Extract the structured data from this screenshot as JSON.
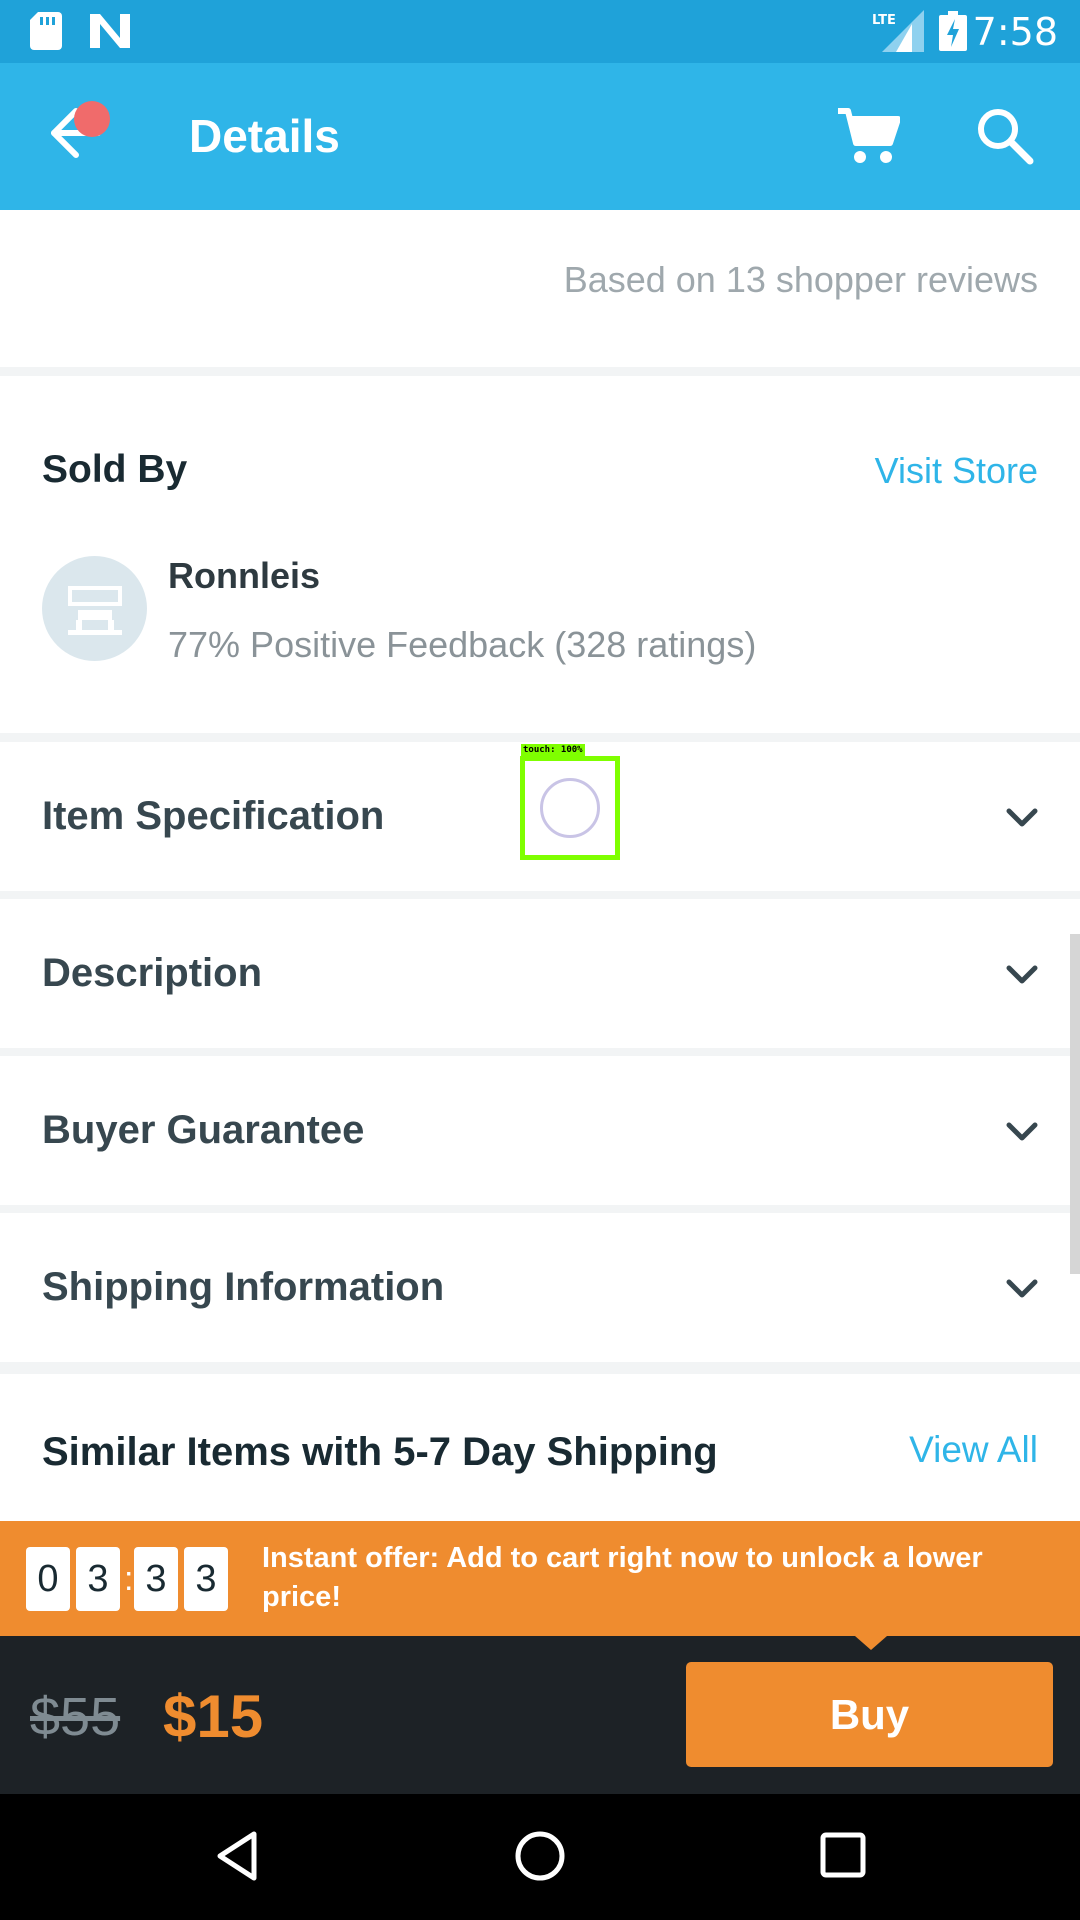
{
  "status_bar": {
    "network_label": "LTE",
    "time": "7:58"
  },
  "app_bar": {
    "title": "Details",
    "icons": [
      "back-arrow-icon",
      "notification-dot",
      "cart-icon",
      "search-icon"
    ]
  },
  "reviews": {
    "summary": "Based on 13 shopper reviews"
  },
  "seller": {
    "section_title": "Sold By",
    "visit_store_label": "Visit Store",
    "name": "Ronnleis",
    "feedback": "77% Positive Feedback (328 ratings)"
  },
  "accordion": [
    {
      "label": "Item Specification"
    },
    {
      "label": "Description"
    },
    {
      "label": "Buyer Guarantee"
    },
    {
      "label": "Shipping Information"
    }
  ],
  "touch_overlay": {
    "label": "touch: 100%"
  },
  "similar": {
    "title": "Similar Items with 5-7 Day Shipping",
    "view_all_label": "View All"
  },
  "offer": {
    "timer_digits": [
      "0",
      "3",
      "3",
      "3"
    ],
    "separator": ":",
    "text": "Instant offer: Add to cart right now to unlock a lower price!"
  },
  "purchase": {
    "old_price": "$55",
    "new_price": "$15",
    "buy_label": "Buy"
  },
  "colors": {
    "status_bar": "#1fa2d9",
    "app_bar": "#2fb5e8",
    "accent_orange": "#ef8c2f",
    "link_blue": "#2fb5e8",
    "buy_bar": "#1d2226"
  }
}
